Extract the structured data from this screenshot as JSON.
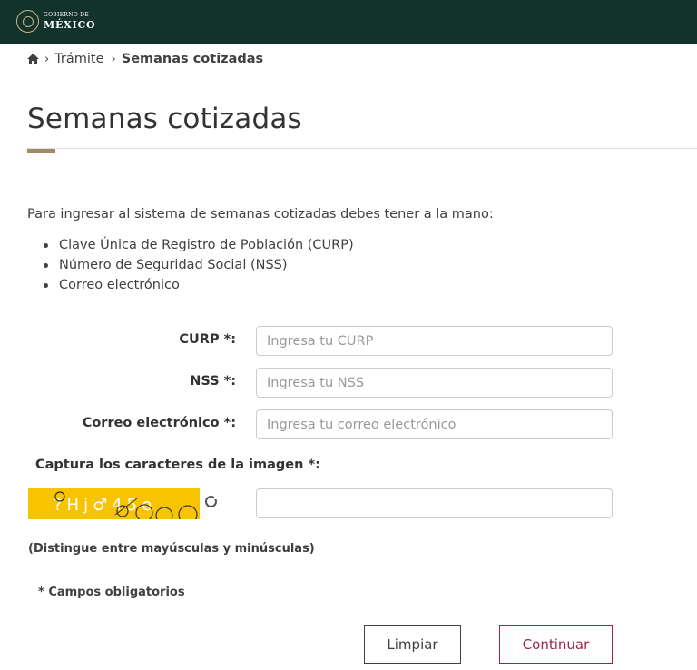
{
  "header": {
    "logo_line1": "GOBIERNO DE",
    "logo_line2": "MÉXICO",
    "background_color": "#13322b"
  },
  "breadcrumb": {
    "home_icon": "home-icon",
    "items": [
      "Trámite",
      "Semanas cotizadas"
    ],
    "separator": "›"
  },
  "page": {
    "title": "Semanas cotizadas",
    "accent_color": "#a38a63",
    "intro": "Para ingresar al sistema de semanas cotizadas debes tener a la mano:",
    "requirements": [
      "Clave Única de Registro de Población (CURP)",
      "Número de Seguridad Social (NSS)",
      "Correo electrónico"
    ]
  },
  "form": {
    "curp": {
      "label": "CURP *:",
      "placeholder": "Ingresa tu CURP",
      "value": ""
    },
    "nss": {
      "label": "NSS *:",
      "placeholder": "Ingresa tu NSS",
      "value": ""
    },
    "email": {
      "label": "Correo electrónico *:",
      "placeholder": "Ingresa tu correo electrónico",
      "value": ""
    },
    "captcha": {
      "label": "Captura los caracteres de la imagen *:",
      "image_text": "?Hj♂45e",
      "background_color": "#f8c401",
      "refresh_icon": "refresh-icon",
      "value": ""
    },
    "case_hint": "(Distingue entre mayúsculas y minúsculas)",
    "required_note": "* Campos obligatorios"
  },
  "buttons": {
    "clear": "Limpiar",
    "continue": "Continuar",
    "continue_color": "#9d2449"
  }
}
